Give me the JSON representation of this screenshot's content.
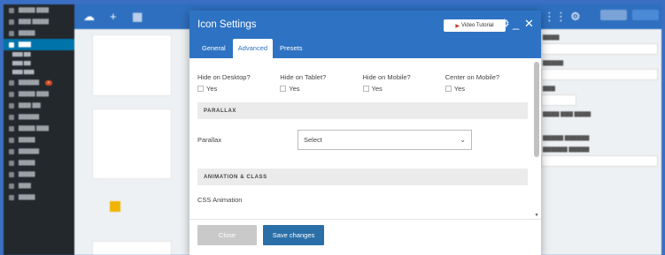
{
  "modal": {
    "title": "Icon Settings",
    "video_button": "Video Tutorial",
    "tabs": [
      {
        "label": "General",
        "active": false
      },
      {
        "label": "Advanced",
        "active": true
      },
      {
        "label": "Presets",
        "active": false
      }
    ],
    "visibility": [
      {
        "title": "Hide on Desktop?",
        "option": "Yes",
        "checked": false
      },
      {
        "title": "Hide on Tablet?",
        "option": "Yes",
        "checked": false
      },
      {
        "title": "Hide on Mobile?",
        "option": "Yes",
        "checked": false
      },
      {
        "title": "Center on Mobile?",
        "option": "Yes",
        "checked": false
      }
    ],
    "sections": {
      "parallax_heading": "PARALLAX",
      "parallax_label": "Parallax",
      "parallax_value": "Select",
      "animation_heading": "ANIMATION & CLASS",
      "css_animation_label": "CSS Animation"
    },
    "footer": {
      "close_label": "Close",
      "save_label": "Save changes"
    }
  },
  "colors": {
    "header": "#2e73c3",
    "accent": "#2b6fa8",
    "frame": "#3a6fc4",
    "sidebar": "#23282d"
  }
}
